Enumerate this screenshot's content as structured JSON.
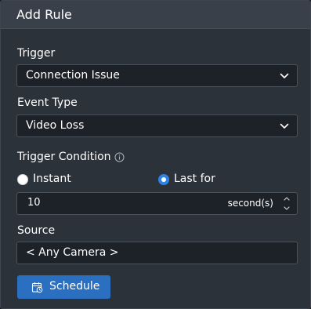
{
  "dialog": {
    "title": "Add Rule"
  },
  "trigger": {
    "label": "Trigger",
    "value": "Connection Issue"
  },
  "event_type": {
    "label": "Event Type",
    "value": "Video Loss"
  },
  "trigger_condition": {
    "label": "Trigger Condition",
    "options": [
      {
        "label": "Instant",
        "selected": false
      },
      {
        "label": "Last for",
        "selected": true
      }
    ],
    "duration_value": "10",
    "duration_unit": "second(s)"
  },
  "source": {
    "label": "Source",
    "value": "< Any Camera >"
  },
  "schedule_button": {
    "label": "Schedule"
  },
  "icons": {
    "info": "info-icon",
    "chevron": "chevron-down-icon",
    "stepper": "spinner-arrows-icon",
    "schedule": "calendar-icon"
  },
  "colors": {
    "panel_bg": "#2c323a",
    "header_bg": "#3a4049",
    "field_bg": "#1d2128",
    "accent": "#2d84e4",
    "button_bg": "#2a6fc0"
  }
}
